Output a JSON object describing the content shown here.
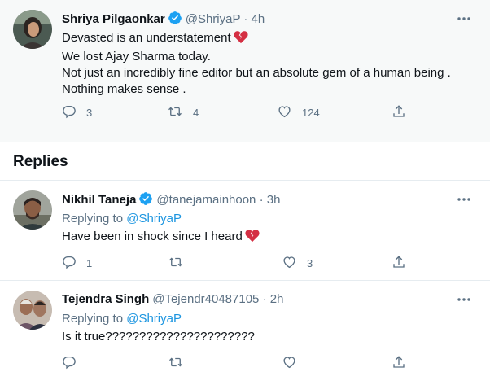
{
  "main_tweet": {
    "author_name": "Shriya Pilgaonkar",
    "handle": "@ShriyaP",
    "separator": "·",
    "time": "4h",
    "lines": [
      "Devasted is an understatement",
      "We lost Ajay Sharma today.",
      "Not just an incredibly fine editor but an absolute gem of a human being .",
      "Nothing makes sense ."
    ],
    "emoji": "broken-heart",
    "replies_count": "3",
    "retweets_count": "4",
    "likes_count": "124"
  },
  "replies_section": {
    "title": "Replies"
  },
  "replies": [
    {
      "author_name": "Nikhil Taneja",
      "handle": "@tanejamainhoon",
      "separator": "·",
      "time": "3h",
      "replying_to_label": "Replying to",
      "replying_to_handle": "@ShriyaP",
      "text": "Have been in shock since I heard",
      "emoji": "broken-heart",
      "replies_count": "1",
      "retweets_count": "",
      "likes_count": "3",
      "verified": true
    },
    {
      "author_name": "Tejendra Singh",
      "handle": "@Tejendr40487105",
      "separator": "·",
      "time": "2h",
      "replying_to_label": "Replying to",
      "replying_to_handle": "@ShriyaP",
      "text": "Is it true??????????????????????",
      "replies_count": "",
      "retweets_count": "",
      "likes_count": "",
      "verified": false
    }
  ],
  "colors": {
    "verified_blue": "#1da1f2",
    "link_blue": "#1b95e0",
    "secondary_text": "#5b7083",
    "broken_heart_red": "#d42f43"
  }
}
